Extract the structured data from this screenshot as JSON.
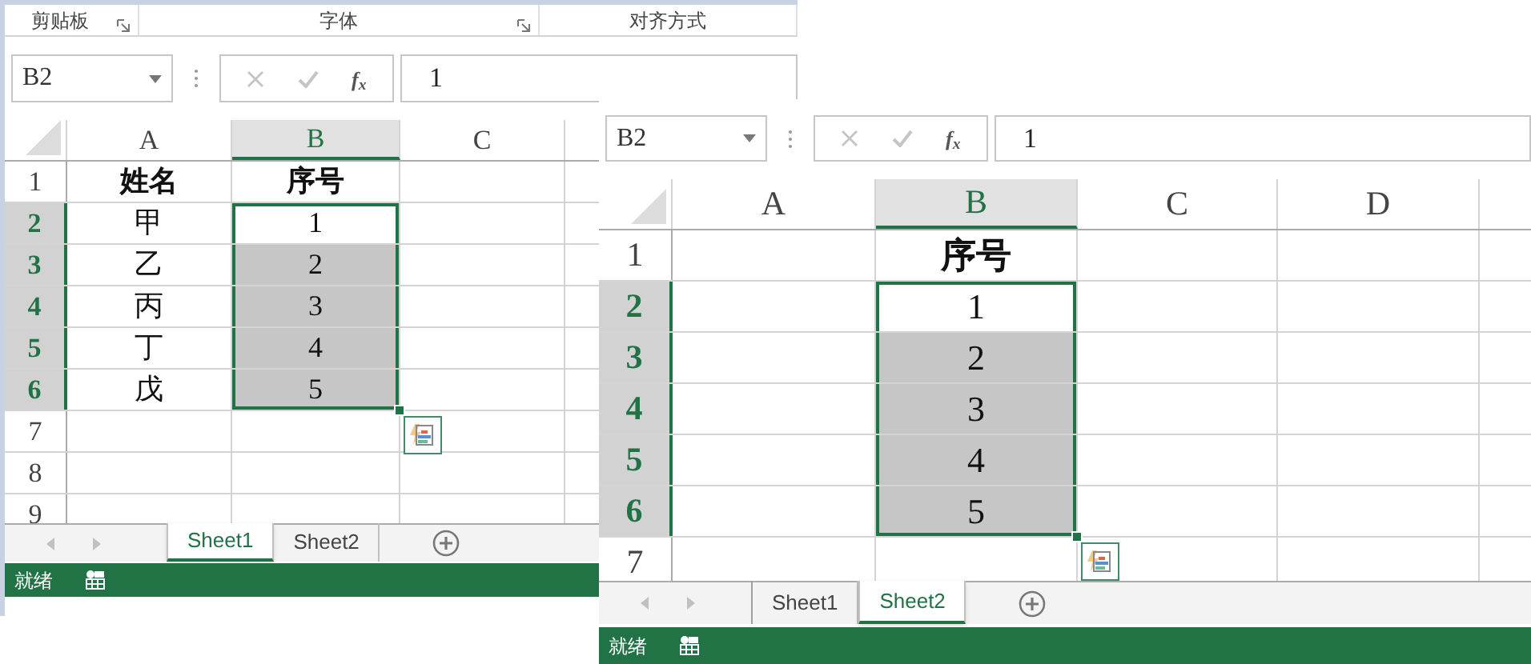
{
  "windows": [
    {
      "ribbon_groups": [
        {
          "label": "剪贴板",
          "launcher": true
        },
        {
          "label": "字体",
          "launcher": true
        },
        {
          "label": "对齐方式",
          "launcher": false
        }
      ],
      "name_box": "B2",
      "function_button": "f$_{x}$",
      "formula": "1",
      "columns": [
        {
          "label": "A",
          "selected": false
        },
        {
          "label": "B",
          "selected": true
        },
        {
          "label": "C",
          "selected": false
        }
      ],
      "rows": [
        {
          "header": "1",
          "selected": false,
          "cells": [
            {
              "text": "姓名",
              "bold": true,
              "selected": false,
              "shaded": false
            },
            {
              "text": "序号",
              "bold": true,
              "selected": false,
              "shaded": false
            }
          ]
        },
        {
          "header": "2",
          "selected": true,
          "cells": [
            {
              "text": "甲",
              "bold": false,
              "selected": false,
              "shaded": false
            },
            {
              "text": "1",
              "bold": false,
              "selected": true,
              "shaded": false
            }
          ]
        },
        {
          "header": "3",
          "selected": true,
          "cells": [
            {
              "text": "乙",
              "bold": false,
              "selected": false,
              "shaded": false
            },
            {
              "text": "2",
              "bold": false,
              "selected": true,
              "shaded": true
            }
          ]
        },
        {
          "header": "4",
          "selected": true,
          "cells": [
            {
              "text": "丙",
              "bold": false,
              "selected": false,
              "shaded": false
            },
            {
              "text": "3",
              "bold": false,
              "selected": true,
              "shaded": true
            }
          ]
        },
        {
          "header": "5",
          "selected": true,
          "cells": [
            {
              "text": "丁",
              "bold": false,
              "selected": false,
              "shaded": false
            },
            {
              "text": "4",
              "bold": false,
              "selected": true,
              "shaded": true
            }
          ]
        },
        {
          "header": "6",
          "selected": true,
          "cells": [
            {
              "text": "戊",
              "bold": false,
              "selected": false,
              "shaded": false
            },
            {
              "text": "5",
              "bold": false,
              "selected": true,
              "shaded": true
            }
          ]
        },
        {
          "header": "7",
          "selected": false
        },
        {
          "header": "8",
          "selected": false
        },
        {
          "header": "9",
          "selected": false
        }
      ],
      "quick_analysis_button": true,
      "sheet_tabs": [
        {
          "label": "Sheet1",
          "selected": true
        },
        {
          "label": "Sheet2",
          "selected": false
        }
      ],
      "status": "就绪"
    },
    {
      "name_box": "B2",
      "function_button": "f$_{x}$",
      "formula": "1",
      "columns": [
        {
          "label": "A",
          "selected": false
        },
        {
          "label": "B",
          "selected": true
        },
        {
          "label": "C",
          "selected": false
        },
        {
          "label": "D",
          "selected": false
        }
      ],
      "rows": [
        {
          "header": "1",
          "selected": false,
          "cells": [
            {
              "selected": false,
              "shaded": false
            },
            {
              "text": "序号",
              "bold": true,
              "selected": false,
              "shaded": false
            }
          ]
        },
        {
          "header": "2",
          "selected": true,
          "cells": [
            {
              "selected": false,
              "shaded": false
            },
            {
              "text": "1",
              "bold": false,
              "selected": true,
              "shaded": false
            }
          ]
        },
        {
          "header": "3",
          "selected": true,
          "cells": [
            {
              "selected": false,
              "shaded": false
            },
            {
              "text": "2",
              "bold": false,
              "selected": true,
              "shaded": true
            }
          ]
        },
        {
          "header": "4",
          "selected": true,
          "cells": [
            {
              "selected": false,
              "shaded": false
            },
            {
              "text": "3",
              "bold": false,
              "selected": true,
              "shaded": true
            }
          ]
        },
        {
          "header": "5",
          "selected": true,
          "cells": [
            {
              "selected": false,
              "shaded": false
            },
            {
              "text": "4",
              "bold": false,
              "selected": true,
              "shaded": true
            }
          ]
        },
        {
          "header": "6",
          "selected": true,
          "cells": [
            {
              "selected": false,
              "shaded": false
            },
            {
              "text": "5",
              "bold": false,
              "selected": true,
              "shaded": true
            }
          ]
        },
        {
          "header": "7",
          "selected": false
        }
      ],
      "quick_analysis_button": true,
      "sheet_tabs": [
        {
          "label": "Sheet1",
          "selected": false
        },
        {
          "label": "Sheet2",
          "selected": true
        }
      ],
      "status": "就绪"
    }
  ]
}
